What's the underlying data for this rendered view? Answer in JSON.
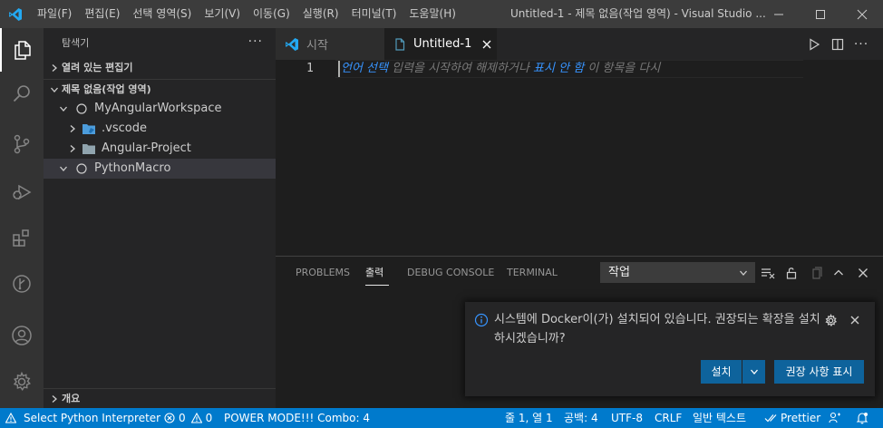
{
  "titlebar": {
    "menus": [
      "파일(F)",
      "편집(E)",
      "선택 영역(S)",
      "보기(V)",
      "이동(G)",
      "실행(R)",
      "터미널(T)",
      "도움말(H)"
    ],
    "window_title": "Untitled-1 - 제목 없음(작업 영역) - Visual Studio ..."
  },
  "sidebar": {
    "title": "탐색기",
    "more": "···",
    "open_editors": "열려 있는 편집기",
    "workspace": "제목 없음(작업 영역)",
    "tree": [
      {
        "label": "MyAngularWorkspace"
      },
      {
        "label": ".vscode"
      },
      {
        "label": "Angular-Project"
      },
      {
        "label": "PythonMacro"
      }
    ],
    "outline": "개요"
  },
  "tabs": {
    "start": "시작",
    "untitled": "Untitled-1"
  },
  "editor": {
    "line_number": "1",
    "placeholder_a": "언어 선택",
    "placeholder_b": " 입력을 시작하여 해제하거나 ",
    "placeholder_c": "표시 안 함",
    "placeholder_d": " 이 항목을 다시"
  },
  "panel": {
    "tabs": [
      "PROBLEMS",
      "출력",
      "DEBUG CONSOLE",
      "TERMINAL"
    ],
    "output_select": "작업"
  },
  "notification": {
    "message": "시스템에 Docker이(가) 설치되어 있습니다. 권장되는 확장을 설치하시겠습니까?",
    "install": "설치",
    "recommend": "권장 사항 표시"
  },
  "statusbar": {
    "python": "Select Python Interpreter",
    "errors": "0",
    "warnings": "0",
    "power_mode": "POWER MODE!!! Combo: 4",
    "position": "줄 1, 열 1",
    "spaces": "공백: 4",
    "encoding": "UTF-8",
    "eol": "CRLF",
    "language": "일반 텍스트",
    "prettier": "Prettier"
  },
  "colors": {
    "accent": "#007acc",
    "button": "#0e639c",
    "link": "#3794ff",
    "vscode_logo": "#23a9f2"
  }
}
